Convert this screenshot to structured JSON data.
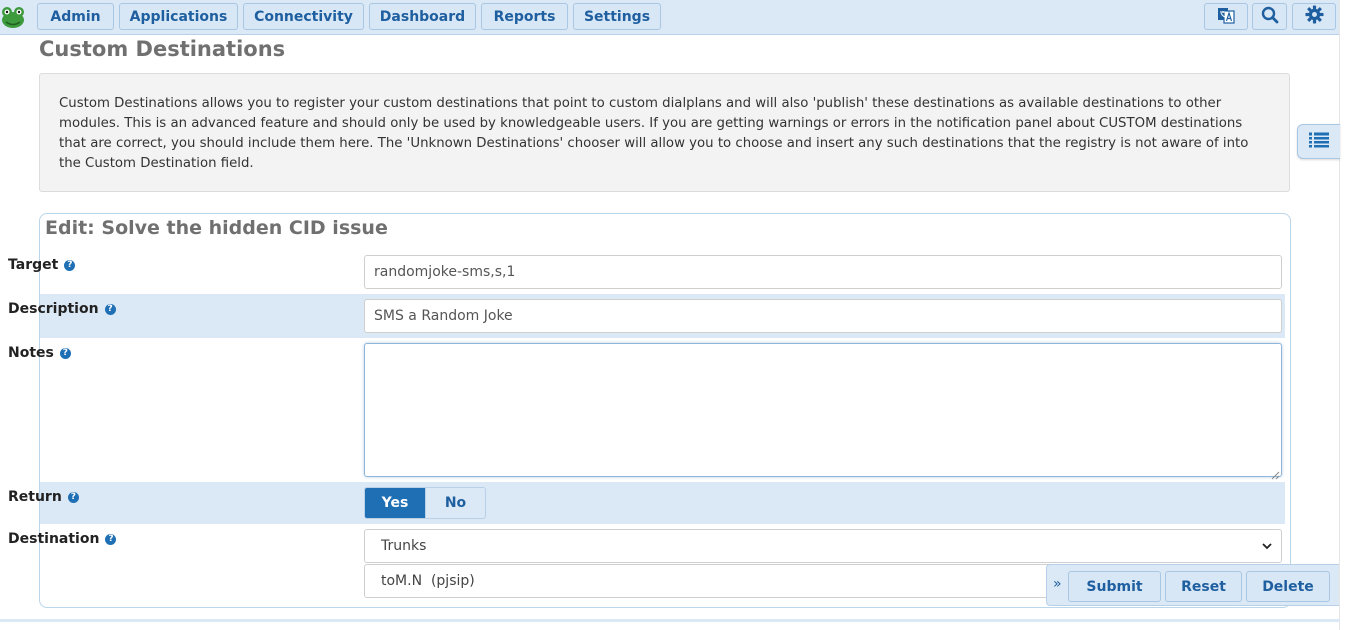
{
  "nav": {
    "items": [
      "Admin",
      "Applications",
      "Connectivity",
      "Dashboard",
      "Reports",
      "Settings"
    ]
  },
  "icons": {
    "logo": "frog-logo-icon",
    "translate": "translate-icon",
    "search": "search-icon",
    "settings": "gear-icon",
    "sidebar": "list-icon"
  },
  "colors": {
    "accent": "#1f6fb5",
    "nav_bg": "#dbe9f6",
    "logo_green": "#3d9a3d"
  },
  "page": {
    "title": "Custom Destinations",
    "info": "Custom Destinations allows you to register your custom destinations that point to custom dialplans and will also 'publish' these destinations as available destinations to other modules. This is an advanced feature and should only be used by knowledgeable users. If you are getting warnings or errors in the notification panel about CUSTOM destinations that are correct, you should include them here. The 'Unknown Destinations' chooser will allow you to choose and insert any such destinations that the registry is not aware of into the Custom Destination field."
  },
  "form": {
    "title": "Edit: Solve the hidden CID issue",
    "target": {
      "label": "Target",
      "value": "randomjoke-sms,s,1"
    },
    "description": {
      "label": "Description",
      "value": "SMS a Random Joke"
    },
    "notes": {
      "label": "Notes",
      "value": ""
    },
    "return": {
      "label": "Return",
      "yes": "Yes",
      "no": "No",
      "selected": "Yes"
    },
    "destination": {
      "label": "Destination",
      "type": "Trunks",
      "value": "toM.N  (pjsip)"
    }
  },
  "actions": {
    "submit": "Submit",
    "reset": "Reset",
    "delete": "Delete"
  }
}
